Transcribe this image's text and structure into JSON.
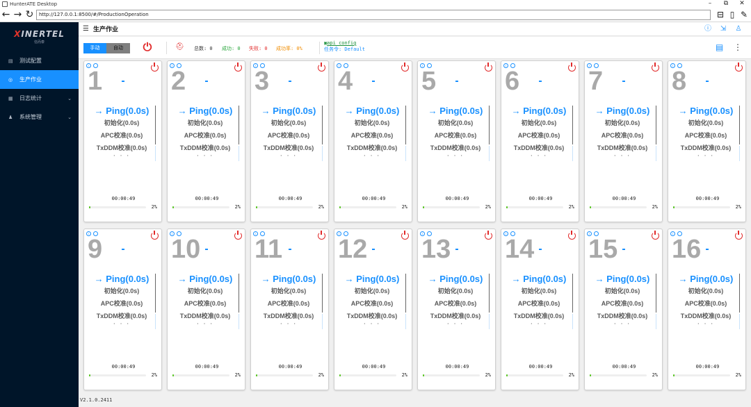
{
  "window": {
    "title": "HunterATE Desktop",
    "min": "–",
    "max": "⧉",
    "close": "✕"
  },
  "browser": {
    "url": "http://127.0.0.1:8500/#/ProductionOperation",
    "back": "←",
    "forward": "→",
    "reload": "↻"
  },
  "sidebar": {
    "brand": "XINERTEL",
    "brand_x": "X",
    "brand_rest": "INERTEL",
    "brand_sub": "信而泰",
    "items": [
      {
        "label": "测试配置",
        "icon": "doc-icon"
      },
      {
        "label": "生产作业",
        "icon": "gear-icon",
        "active": true
      },
      {
        "label": "日志统计",
        "icon": "log-icon",
        "expandable": true
      },
      {
        "label": "系统管理",
        "icon": "user-icon",
        "expandable": true
      }
    ]
  },
  "header": {
    "title": "生产作业"
  },
  "toolbar": {
    "mode_manual": "手动",
    "mode_auto": "自动",
    "stats": {
      "total": "总数: 0",
      "success": "成功: 0",
      "fail": "失败: 0",
      "rate": "成功率: 0%"
    },
    "config_link": "api_config",
    "task": "任务令: Default",
    "colors": {
      "success": "#27a53a",
      "fail": "#e12a2a",
      "rate": "#f08c00"
    }
  },
  "cards": [
    {
      "number": "1"
    },
    {
      "number": "2"
    },
    {
      "number": "3"
    },
    {
      "number": "4"
    },
    {
      "number": "5"
    },
    {
      "number": "6"
    },
    {
      "number": "7"
    },
    {
      "number": "8"
    },
    {
      "number": "9"
    },
    {
      "number": "10"
    },
    {
      "number": "11"
    },
    {
      "number": "12"
    },
    {
      "number": "13"
    },
    {
      "number": "14"
    },
    {
      "number": "15"
    },
    {
      "number": "16"
    }
  ],
  "card_common": {
    "step_current": "→ Ping(0.0s)",
    "step_2": "初始化(0.0s)",
    "step_3": "APC校准(0.0s)",
    "step_4": "TxDDM校准(0.0s)",
    "step_5": "· · ·",
    "time": "00:00:49",
    "progress_text": "2%",
    "progress": 0.02
  },
  "footer": {
    "version": "V2.1.0.2411"
  }
}
